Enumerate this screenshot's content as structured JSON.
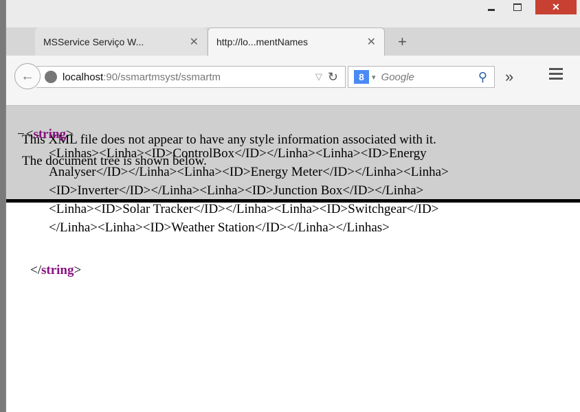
{
  "window": {
    "minimize_glyph": "",
    "close_glyph": "✕"
  },
  "tabs": [
    {
      "title": "MSService Serviço W...",
      "active": false
    },
    {
      "title": "http://lo...mentNames",
      "active": true
    }
  ],
  "tab_close_glyph": "✕",
  "new_tab_glyph": "+",
  "nav": {
    "url_host": "localhost",
    "url_rest": ":90/ssmartmsyst/ssmartm",
    "search_placeholder": "Google",
    "search_engine_letter": "8",
    "overflow_glyph": "»"
  },
  "banner": {
    "line1": "This XML file does not appear to have any style information associated with it.",
    "line2": "The document tree is shown below."
  },
  "xml": {
    "toggle": "−",
    "open_lt": "<",
    "tag": "string",
    "open_gt": ">",
    "close_lt": "</",
    "close_gt": ">",
    "lines": [
      "<Linhas><Linha><ID>ControlBox</ID></Linha><Linha><ID>Energy",
      "Analyser</ID></Linha><Linha><ID>Energy Meter</ID></Linha><Linha>",
      "<ID>Inverter</ID></Linha><Linha><ID>Junction Box</ID></Linha>",
      "<Linha><ID>Solar Tracker</ID></Linha><Linha><ID>Switchgear</ID>",
      "</Linha><Linha><ID>Weather Station</ID></Linha></Linhas>"
    ]
  },
  "colors": {
    "tag": "#881280",
    "close_button": "#c84031",
    "banner_bg": "#cfcfcf"
  }
}
